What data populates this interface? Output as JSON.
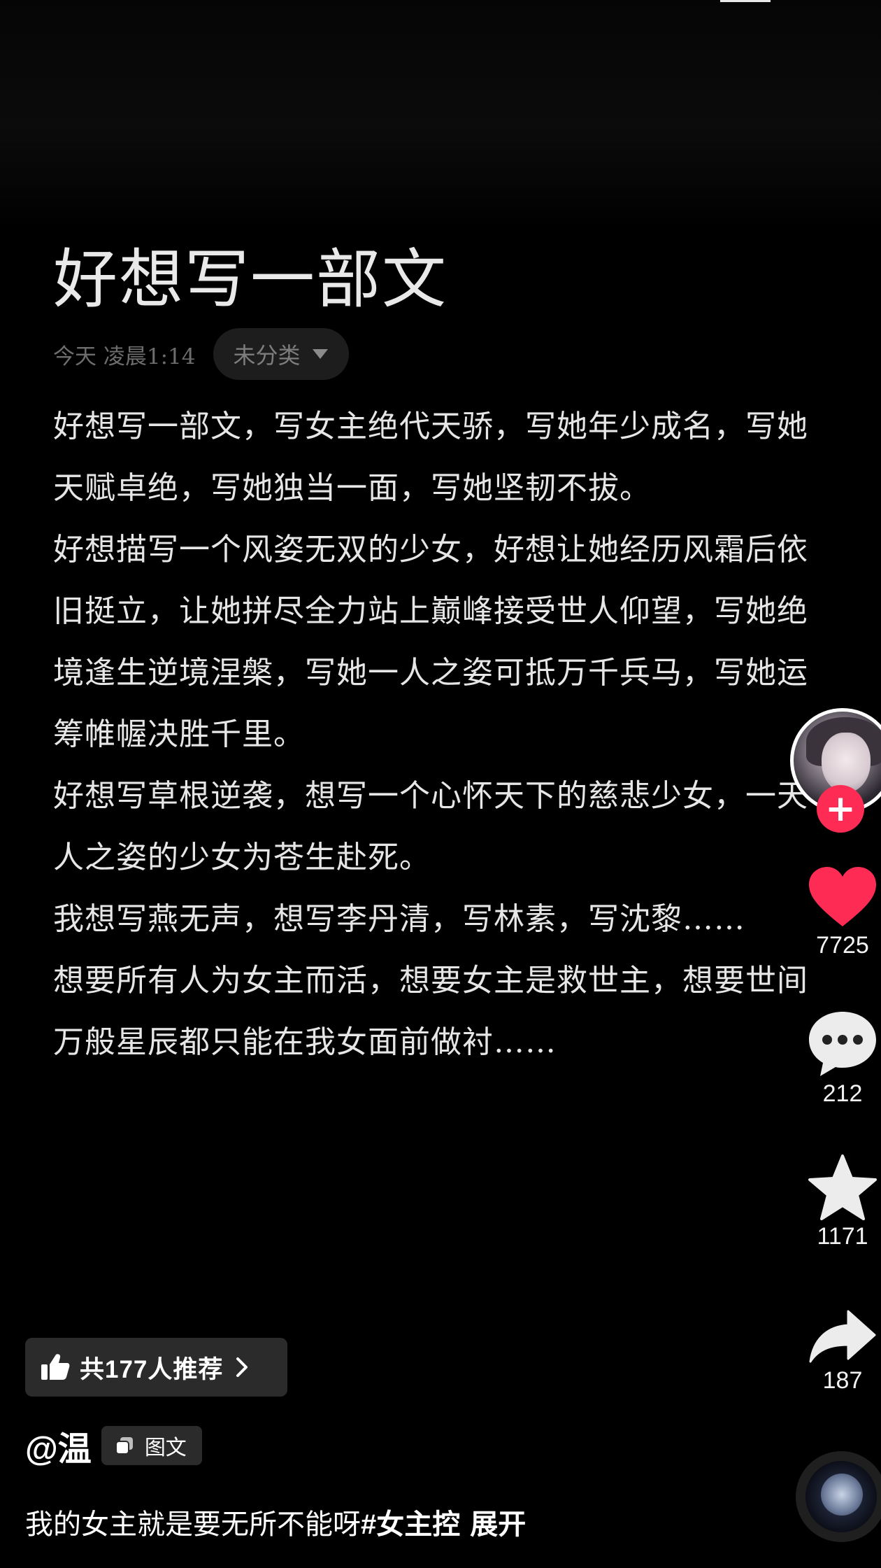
{
  "note": {
    "title": "好想写一部文",
    "date": "今天  凌晨1:14",
    "category": "未分类",
    "paragraphs": [
      "好想写一部文，写女主绝代天骄，写她年少成名，写她天赋卓绝，写她独当一面，写她坚韧不拔。",
      "好想描写一个风姿无双的少女，好想让她经历风霜后依旧挺立，让她拼尽全力站上巅峰接受世人仰望，写她绝境逢生逆境涅槃，写她一人之姿可抵万千兵马，写她运筹帷幄决胜千里。",
      "好想写草根逆袭，想写一个心怀天下的慈悲少女，一天人之姿的少女为苍生赴死。",
      "我想写燕无声，想写李丹清，写林素，写沈黎……",
      "想要所有人为女主而活，想要女主是救世主，想要世间万般星辰都只能在我女面前做衬……"
    ]
  },
  "rail": {
    "follow_symbol": "+",
    "likes": "7725",
    "comments": "212",
    "favorites": "1171",
    "shares": "187",
    "like_color": "#fe2c55"
  },
  "bottom": {
    "recommend_label": "共177人推荐",
    "author": "@温",
    "type_tag": "图文",
    "caption_text": "我的女主就是要无所不能呀",
    "caption_hashtag": "#女主控",
    "expand_label": "展开"
  }
}
